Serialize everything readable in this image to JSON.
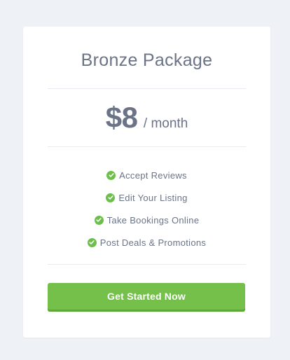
{
  "card": {
    "title": "Bronze Package",
    "price": {
      "amount": "$8",
      "period": "/ month"
    },
    "features": [
      {
        "icon": "check-circle-icon",
        "label": "Accept Reviews"
      },
      {
        "icon": "check-circle-icon",
        "label": "Edit Your Listing"
      },
      {
        "icon": "check-circle-icon",
        "label": "Take Bookings Online"
      },
      {
        "icon": "check-circle-icon",
        "label": "Post Deals & Promotions"
      }
    ],
    "cta_label": "Get Started Now"
  },
  "colors": {
    "background": "#eef1f5",
    "card": "#ffffff",
    "text": "#6b7386",
    "accent_green": "#74c04b",
    "check_green": "#6cc04a"
  }
}
